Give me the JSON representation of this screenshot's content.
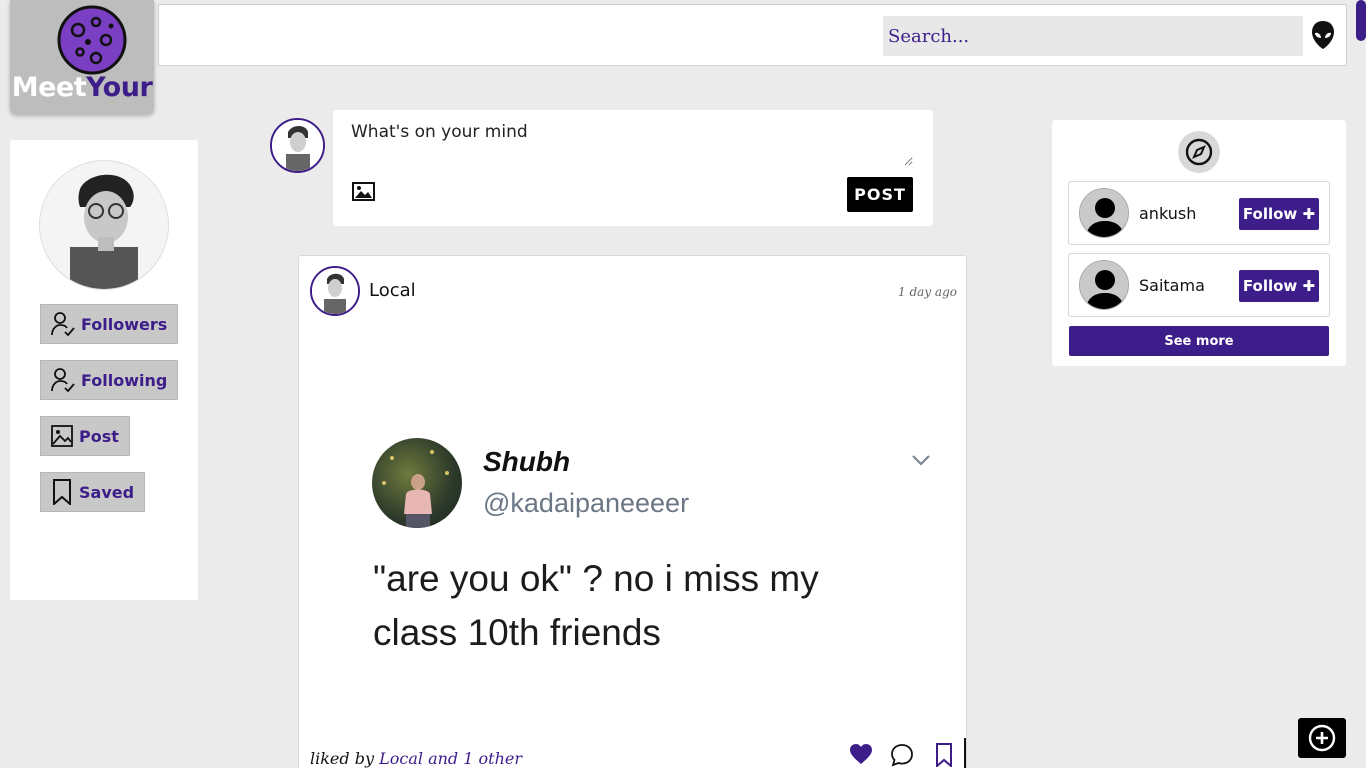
{
  "brand": {
    "word1": "Meet",
    "word2": "Your",
    "logo_icon": "planet-icon"
  },
  "search": {
    "placeholder": "Search..."
  },
  "header": {
    "profile_icon": "alien-icon"
  },
  "sidebar": {
    "avatar_icon": "profile-photo",
    "items": [
      {
        "label": "Followers",
        "icon": "user-check-icon"
      },
      {
        "label": "Following",
        "icon": "user-check-icon"
      },
      {
        "label": "Post",
        "icon": "image-icon"
      },
      {
        "label": "Saved",
        "icon": "bookmark-icon"
      }
    ]
  },
  "composer": {
    "placeholder": "What's on your mind",
    "post_label": "POST",
    "attach_icon": "image-icon"
  },
  "feed": {
    "posts": [
      {
        "user": "Local",
        "time": "1 day ago",
        "tweet": {
          "name": "Shubh",
          "handle": "@kadaipaneeeer",
          "text": "\"are you ok\" ? no i miss my class 10th friends"
        },
        "liked_prefix": "liked by",
        "liked_by": "Local and 1 other",
        "liked": true
      }
    ]
  },
  "suggestions": {
    "icon": "compass-icon",
    "users": [
      {
        "name": "ankush",
        "follow_label": "Follow"
      },
      {
        "name": "Saitama",
        "follow_label": "Follow"
      }
    ],
    "see_more_label": "See more"
  },
  "colors": {
    "accent": "#3d1d8a",
    "background": "#ebebeb"
  },
  "fab": {
    "icon": "plus-circle-icon"
  }
}
